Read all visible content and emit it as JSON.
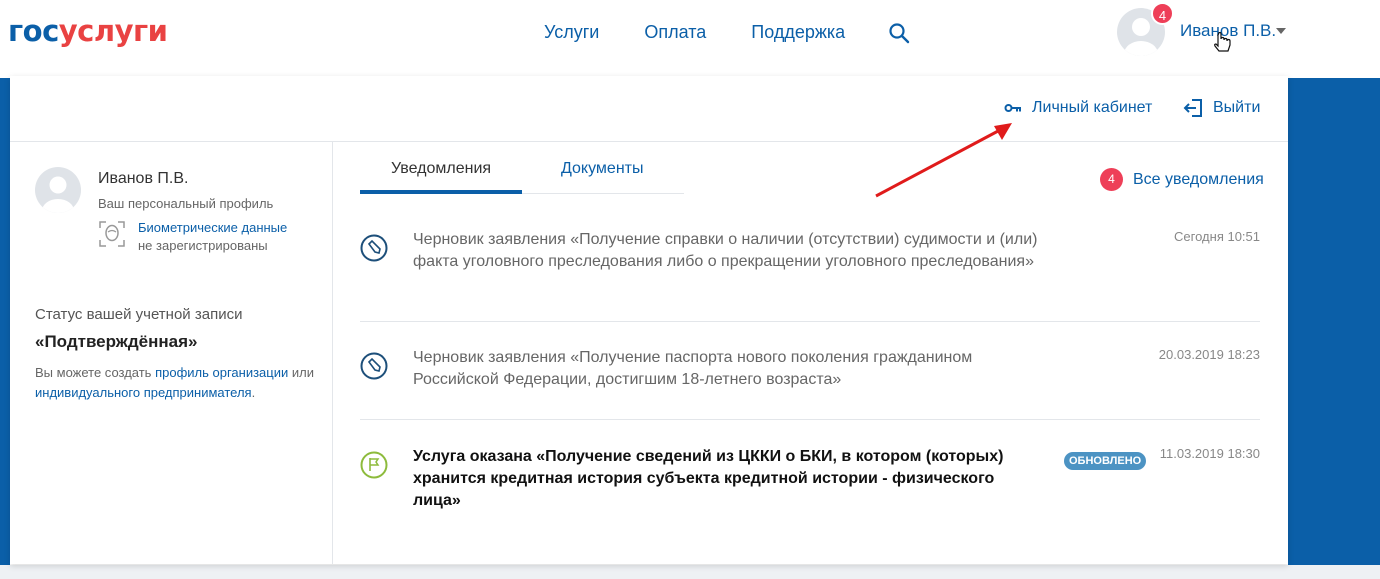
{
  "header": {
    "logo_part1": "гос",
    "logo_part2": "услуги",
    "nav": [
      "Услуги",
      "Оплата",
      "Поддержка"
    ],
    "notification_count": "4",
    "user_name": "Иванов П.В."
  },
  "panel": {
    "cabinet_link": "Личный кабинет",
    "logout_link": "Выйти"
  },
  "profile": {
    "name": "Иванов П.В.",
    "profile_label": "Ваш персональный профиль",
    "biometric_link": "Биометрические данные",
    "biometric_status": "не зарегистрированы",
    "status_label": "Статус вашей учетной записи",
    "status_value": "«Подтверждённая»",
    "note_prefix": "Вы можете создать ",
    "note_link1": "профиль организации",
    "note_middle": " или ",
    "note_link2": "индивидуального предпринимателя",
    "note_suffix": "."
  },
  "tabs": {
    "notifications": "Уведомления",
    "documents": "Документы",
    "all_notifications": "Все уведомления",
    "all_count": "4"
  },
  "notifications": [
    {
      "text": "Черновик заявления «Получение справки о наличии (отсутствии) судимости и (или) факта уголовного преследования либо о прекращении уголовного преследования»",
      "date": "Сегодня 10:51"
    },
    {
      "text": "Черновик заявления «Получение паспорта нового поколения гражданином Российской Федерации, достигшим 18-летнего возраста»",
      "date": "20.03.2019 18:23"
    },
    {
      "text": "Услуга оказана «Получение сведений из ЦККИ о БКИ, в котором (которых) хранится кредитная история субъекта кредитной истории - физического лица»",
      "badge": "ОБНОВЛЕНО",
      "date": "11.03.2019 18:30"
    }
  ],
  "colors": {
    "brand_blue": "#0b5fa8",
    "brand_red": "#e94242",
    "badge_red": "#ee3f58",
    "arrow_red": "#e01b1b"
  }
}
